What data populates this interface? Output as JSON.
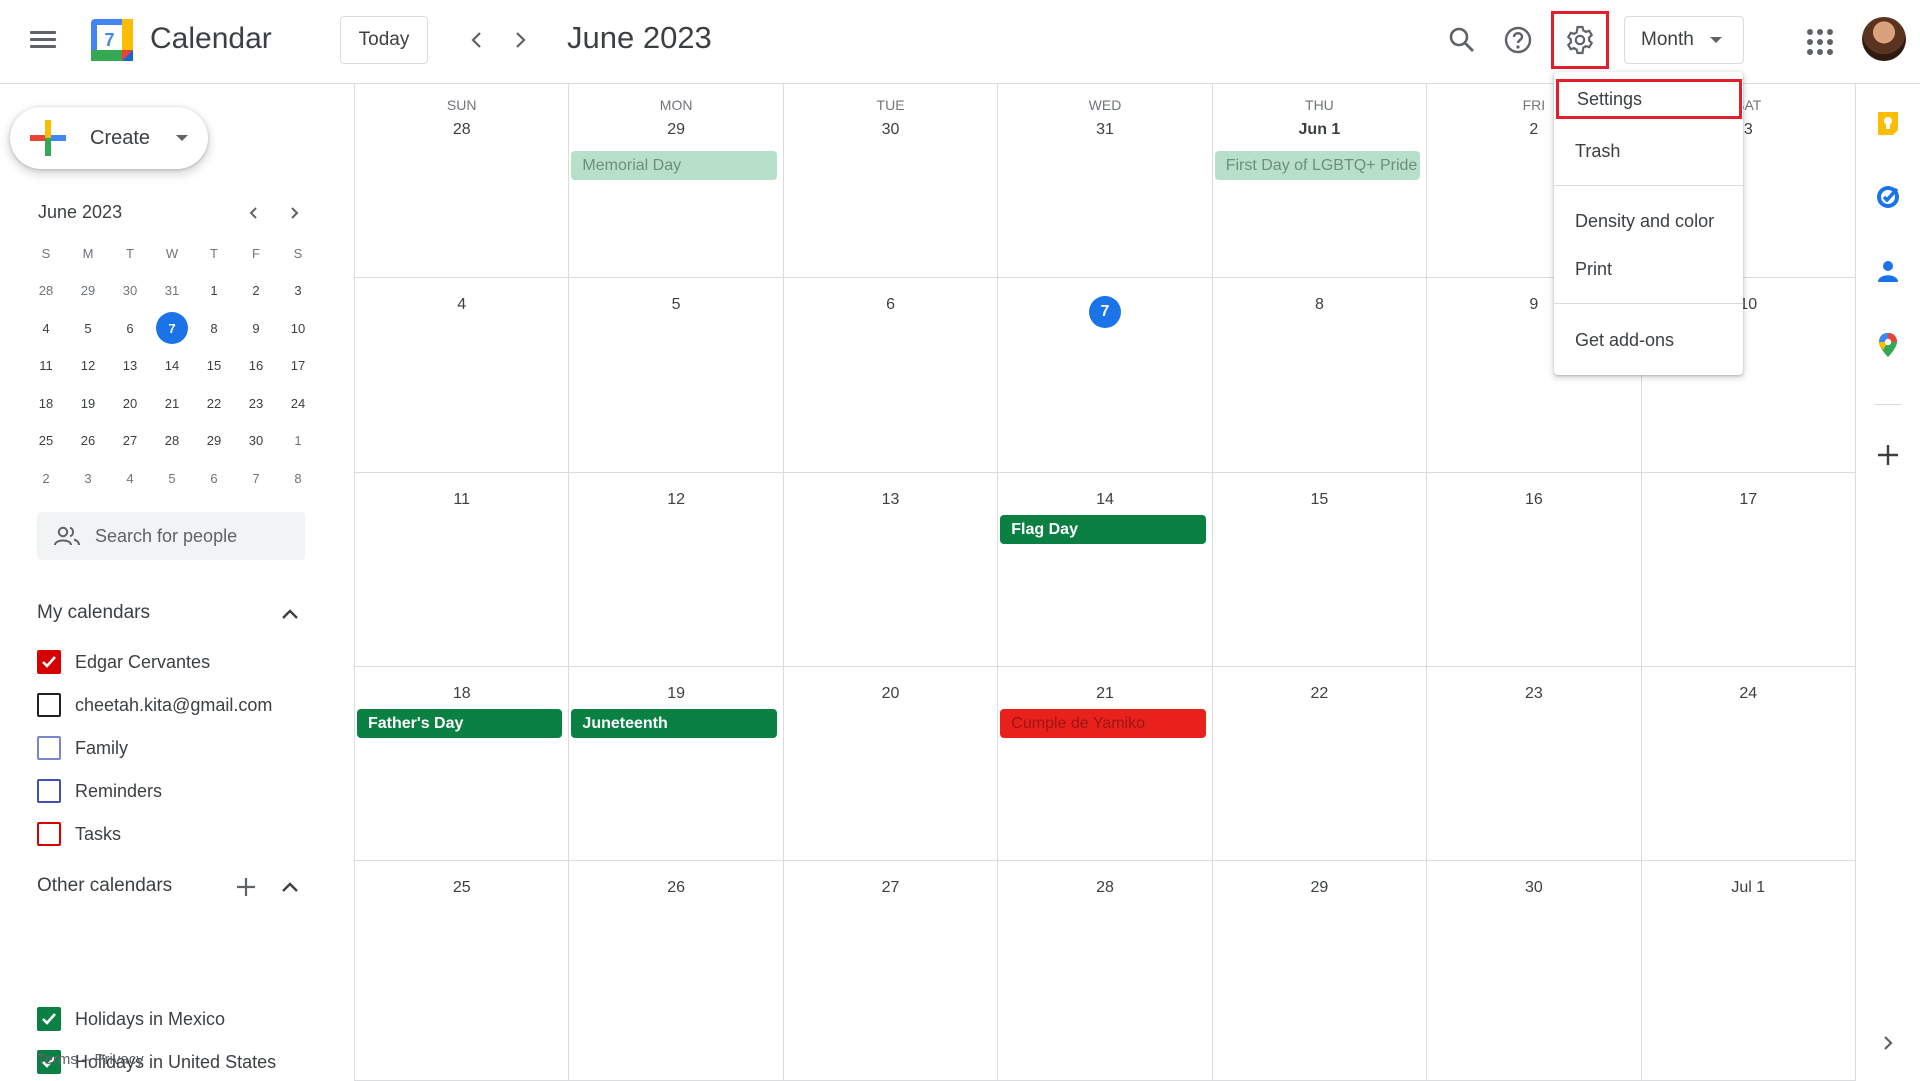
{
  "header": {
    "app_title": "Calendar",
    "logo_day": "7",
    "today_label": "Today",
    "period_title": "June 2023",
    "view_label": "Month"
  },
  "sidebar": {
    "create_label": "Create",
    "mini_calendar": {
      "title": "June 2023",
      "weekday_labels": [
        "S",
        "M",
        "T",
        "W",
        "T",
        "F",
        "S"
      ],
      "weeks": [
        [
          "28",
          "29",
          "30",
          "31",
          "1",
          "2",
          "3"
        ],
        [
          "4",
          "5",
          "6",
          "7",
          "8",
          "9",
          "10"
        ],
        [
          "11",
          "12",
          "13",
          "14",
          "15",
          "16",
          "17"
        ],
        [
          "18",
          "19",
          "20",
          "21",
          "22",
          "23",
          "24"
        ],
        [
          "25",
          "26",
          "27",
          "28",
          "29",
          "30",
          "1"
        ],
        [
          "2",
          "3",
          "4",
          "5",
          "6",
          "7",
          "8"
        ]
      ],
      "today": "7"
    },
    "search_people_placeholder": "Search for people",
    "my_calendars": {
      "title": "My calendars",
      "items": [
        {
          "label": "Edgar Cervantes",
          "color": "#d50000",
          "checked": true
        },
        {
          "label": "cheetah.kita@gmail.com",
          "color": "#202124",
          "checked": false
        },
        {
          "label": "Family",
          "color": "#7986cb",
          "checked": false
        },
        {
          "label": "Reminders",
          "color": "#3f51b5",
          "checked": false
        },
        {
          "label": "Tasks",
          "color": "#d50000",
          "checked": false
        }
      ]
    },
    "other_calendars": {
      "title": "Other calendars",
      "items": [
        {
          "label": "Holidays in Mexico",
          "color": "#0b8043",
          "checked": true
        },
        {
          "label": "Holidays in United States",
          "color": "#0b8043",
          "checked": true
        }
      ]
    },
    "footer": {
      "terms": "Terms",
      "separator": "–",
      "privacy": "Privacy"
    }
  },
  "month": {
    "weekdays": [
      "SUN",
      "MON",
      "TUE",
      "WED",
      "THU",
      "FRI",
      "SAT"
    ],
    "weeks": [
      {
        "days": [
          "28",
          "29",
          "30",
          "31",
          "Jun 1",
          "2",
          "3"
        ],
        "events": [
          {
            "day": 1,
            "title": "Memorial Day",
            "style": "past"
          },
          {
            "day": 4,
            "title": "First Day of LGBTQ+ Pride Month",
            "style": "past"
          }
        ]
      },
      {
        "days": [
          "4",
          "5",
          "6",
          "7",
          "8",
          "9",
          "10"
        ],
        "events": []
      },
      {
        "days": [
          "11",
          "12",
          "13",
          "14",
          "15",
          "16",
          "17"
        ],
        "events": [
          {
            "day": 3,
            "title": "Flag Day",
            "style": "green"
          }
        ]
      },
      {
        "days": [
          "18",
          "19",
          "20",
          "21",
          "22",
          "23",
          "24"
        ],
        "events": [
          {
            "day": 0,
            "title": "Father's Day",
            "style": "green"
          },
          {
            "day": 1,
            "title": "Juneteenth",
            "style": "green"
          },
          {
            "day": 3,
            "title": "Cumple de Yamiko",
            "style": "red"
          }
        ]
      },
      {
        "days": [
          "25",
          "26",
          "27",
          "28",
          "29",
          "30",
          "Jul 1"
        ],
        "events": []
      }
    ],
    "today": "7",
    "bold_day": "Jun 1"
  },
  "settings_menu": {
    "items": [
      "Settings",
      "Trash",
      "Density and color",
      "Print",
      "Get add-ons"
    ],
    "highlighted": "Settings"
  },
  "colors": {
    "accent_blue": "#1a73e8",
    "holiday_green": "#0b8043",
    "birthday_red": "#e8211c",
    "annotation_red": "#e31e2d"
  }
}
